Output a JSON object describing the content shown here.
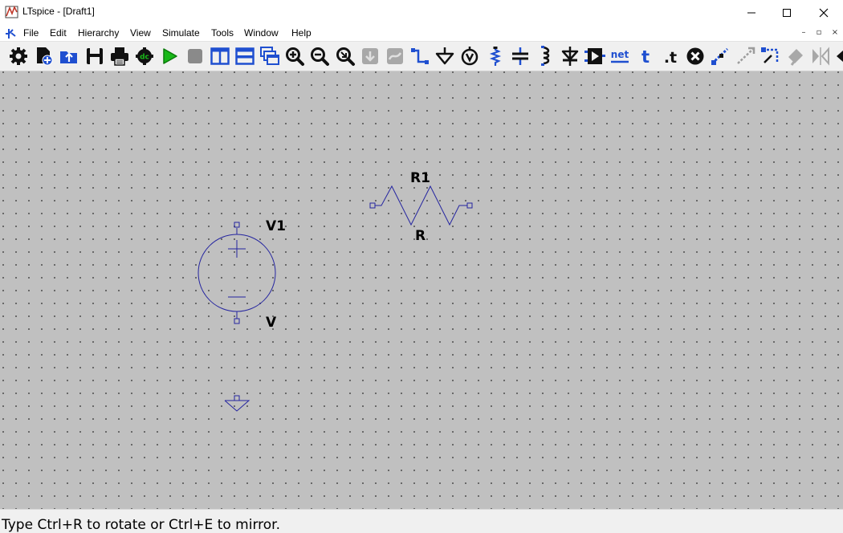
{
  "window": {
    "title": "LTspice - [Draft1]"
  },
  "menu": [
    "File",
    "Edit",
    "Hierarchy",
    "View",
    "Simulate",
    "Tools",
    "Window",
    "Help"
  ],
  "toolbar": {
    "net_label": "net",
    "text_label": "t",
    "spice_label": ".t",
    "dc_label": "dc"
  },
  "schematic": {
    "v1_name": "V1",
    "v1_value": "V",
    "r1_name": "R1",
    "r1_value": "R"
  },
  "status": {
    "text": "Type Ctrl+R to rotate or Ctrl+E to mirror."
  },
  "colors": {
    "wire": "#2525a0",
    "canvas": "#c0c0c0",
    "toolbar_blue": "#1f4fd0",
    "run_green": "#18b818"
  }
}
